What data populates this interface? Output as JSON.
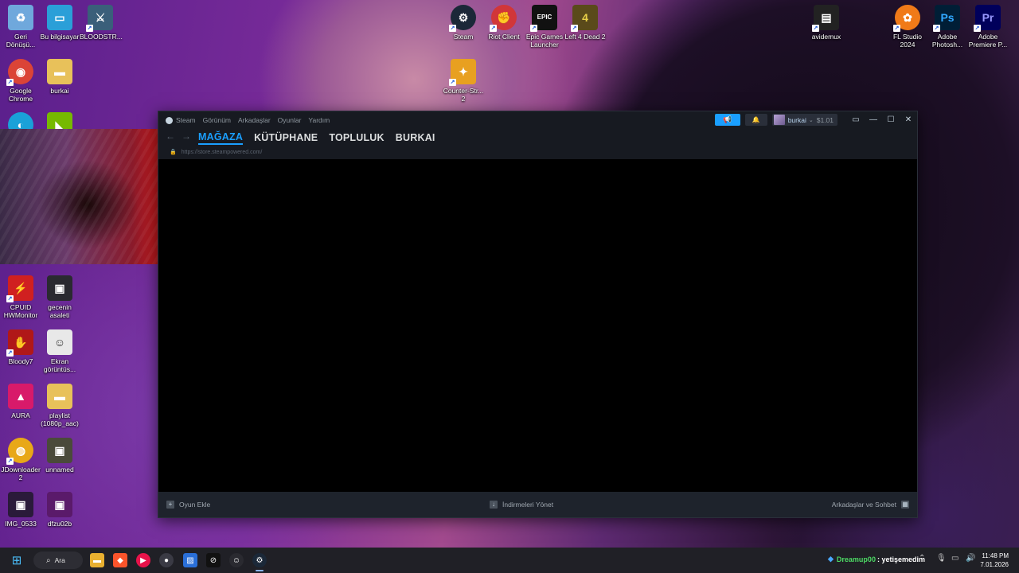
{
  "desktop": {
    "icons_left": [
      {
        "label": "Geri Dönüşü...",
        "glyph": "recycle-bin-icon",
        "color": "#6fa8dc",
        "sym": "♻"
      },
      {
        "label": "Bu bilgisayar",
        "glyph": "computer-icon",
        "color": "#2a9fd8",
        "sym": "▭"
      },
      {
        "label": "BLOODSTR...",
        "glyph": "bloodstrike-icon",
        "color": "#3a5f7a",
        "sym": "⚔"
      },
      {
        "label": "Google Chrome",
        "glyph": "chrome-icon",
        "color": "#db4437",
        "sym": "◉"
      },
      {
        "label": "burkai",
        "glyph": "folder-icon",
        "color": "#e8c15a",
        "sym": "▬"
      },
      {
        "label": "",
        "glyph": "edge-icon",
        "color": "#1aa1d8",
        "sym": "◐"
      },
      {
        "label": "",
        "glyph": "nvidia-icon",
        "color": "#76b900",
        "sym": "◣"
      },
      {
        "label": "CPUID HWMonitor",
        "glyph": "hwmonitor-icon",
        "color": "#d02020",
        "sym": "⚡"
      },
      {
        "label": "gecenin asaleti",
        "glyph": "image-file-icon",
        "color": "#2a2a30",
        "sym": "▣"
      },
      {
        "label": "Bloody7",
        "glyph": "bloody-icon",
        "color": "#b01818",
        "sym": "✋"
      },
      {
        "label": "Ekran görüntüs...",
        "glyph": "screenshot-icon",
        "color": "#e8e8e8",
        "sym": "☺"
      },
      {
        "label": "AURA",
        "glyph": "aura-icon",
        "color": "#d81a6a",
        "sym": "▲"
      },
      {
        "label": "playlist (1080p_aac)",
        "glyph": "folder-icon",
        "color": "#e8c15a",
        "sym": "▬"
      },
      {
        "label": "JDownloader 2",
        "glyph": "jdownloader-icon",
        "color": "#e8a818",
        "sym": "◍"
      },
      {
        "label": "unnamed",
        "glyph": "image-file-icon",
        "color": "#4a4a3a",
        "sym": "▣"
      },
      {
        "label": "IMG_0533",
        "glyph": "image-file-icon",
        "color": "#2a1a3a",
        "sym": "▣"
      },
      {
        "label": "dfzu02b",
        "glyph": "image-file-icon",
        "color": "#5a1a6a",
        "sym": "▣"
      }
    ],
    "icons_top": [
      {
        "label": "Steam",
        "glyph": "steam-icon",
        "color": "#1b2838",
        "sym": "⚙"
      },
      {
        "label": "Riot Client",
        "glyph": "riot-icon",
        "color": "#d13639",
        "sym": "✊"
      },
      {
        "label": "Epic Games Launcher",
        "glyph": "epic-games-icon",
        "color": "#111111",
        "sym": "EPIC"
      },
      {
        "label": "Left 4 Dead 2",
        "glyph": "l4d2-icon",
        "color": "#5a4a1a",
        "sym": "4"
      },
      {
        "label": "Counter-Str... 2",
        "glyph": "cs2-icon",
        "color": "#e8a020",
        "sym": "✦"
      },
      {
        "label": "avidemux",
        "glyph": "avidemux-icon",
        "color": "#222222",
        "sym": "▤"
      },
      {
        "label": "FL Studio 2024",
        "glyph": "fl-studio-icon",
        "color": "#f07a18",
        "sym": "✿"
      },
      {
        "label": "Adobe Photosh...",
        "glyph": "photoshop-icon",
        "color": "#001e36",
        "sym": "Ps"
      },
      {
        "label": "Adobe Premiere P...",
        "glyph": "premiere-icon",
        "color": "#00005b",
        "sym": "Pr"
      }
    ]
  },
  "steam": {
    "menu": [
      "Steam",
      "Görünüm",
      "Arkadaşlar",
      "Oyunlar",
      "Yardım"
    ],
    "account_name": "burkai",
    "balance": "$1.01",
    "tabs": [
      "MAĞAZA",
      "KÜTÜPHANE",
      "TOPLULUK",
      "BURKAI"
    ],
    "url": "https://store.steampowered.com/",
    "bottom": {
      "add_game": "Oyun Ekle",
      "downloads": "İndirmeleri Yönet",
      "friends": "Arkadaşlar ve Sohbet"
    },
    "accent": "#1a9fff"
  },
  "taskbar": {
    "search_label": "Ara",
    "notification_user": "Dreamup00",
    "notification_text": ": yetişemedim",
    "time": "11:48 PM",
    "date": "7.01.2026"
  }
}
